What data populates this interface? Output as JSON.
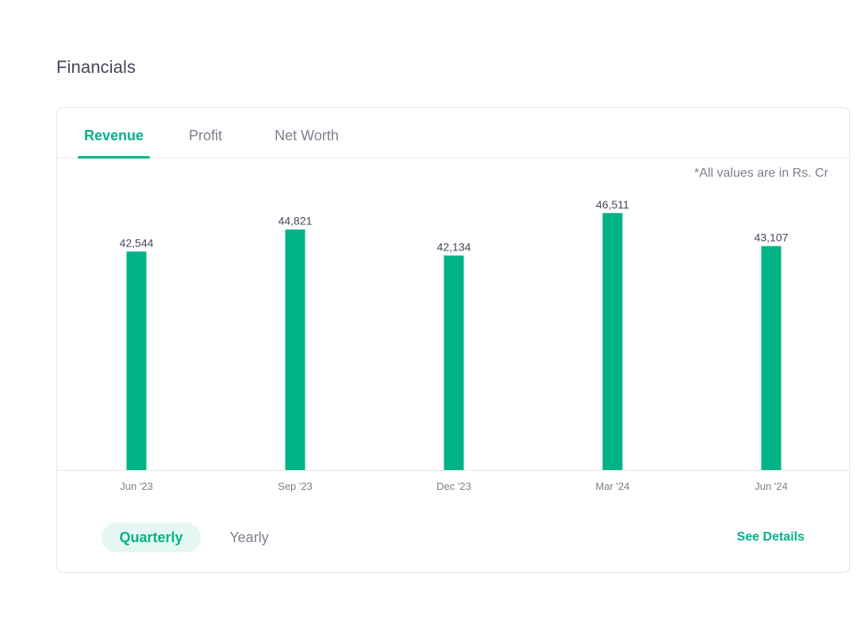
{
  "section": {
    "title": "Financials"
  },
  "tabs": [
    {
      "label": "Revenue",
      "active": true
    },
    {
      "label": "Profit",
      "active": false
    },
    {
      "label": "Net Worth",
      "active": false
    }
  ],
  "unit_note": "*All values are in Rs. Cr",
  "period_toggle": {
    "quarterly_label": "Quarterly",
    "yearly_label": "Yearly",
    "selected": "Quarterly"
  },
  "see_details_label": "See Details",
  "colors": {
    "accent": "#00b386",
    "text": "#44475b",
    "muted": "#7c7e8c"
  },
  "chart_data": {
    "type": "bar",
    "categories": [
      "Jun '23",
      "Sep '23",
      "Dec '23",
      "Mar '24",
      "Jun '24"
    ],
    "values": [
      42544,
      44821,
      42134,
      46511,
      43107
    ],
    "data_labels": [
      "42,544",
      "44,821",
      "42,134",
      "46,511",
      "43,107"
    ],
    "ylim": [
      0,
      48000
    ],
    "grid": false,
    "title": "",
    "xlabel": "",
    "ylabel": ""
  }
}
